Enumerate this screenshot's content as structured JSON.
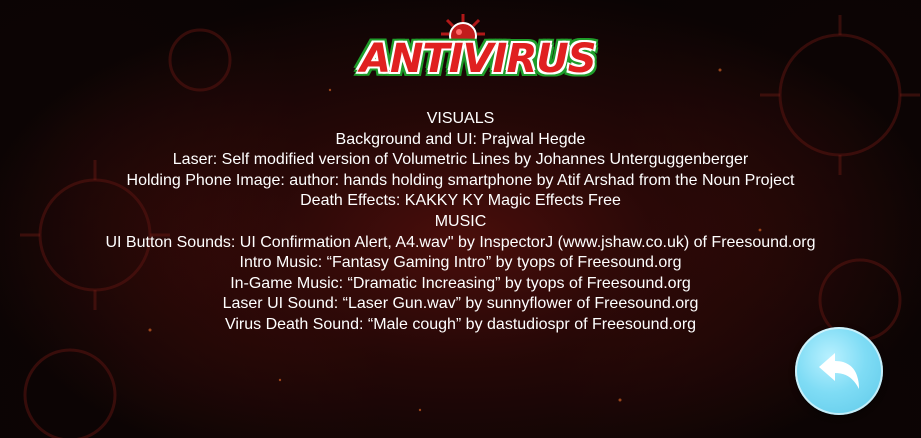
{
  "logo": {
    "text": "ANTIVIRUS",
    "colors": {
      "fill": "#e02020",
      "outline_inner": "#ffffff",
      "outline_outer": "#1f9c2a"
    }
  },
  "credits": {
    "lines": [
      "VISUALS",
      "Background and UI: Prajwal Hegde",
      "Laser: Self modified version of Volumetric Lines by Johannes Unterguggenberger",
      "Holding Phone Image: author: hands holding smartphone by Atif Arshad from the Noun Project",
      "Death Effects: KAKKY KY Magic Effects Free",
      "MUSIC",
      "UI Button Sounds: UI Confirmation Alert, A4.wav\" by InspectorJ (www.jshaw.co.uk) of Freesound.org",
      "Intro Music: “Fantasy Gaming Intro” by tyops of Freesound.org",
      "In-Game Music: “Dramatic Increasing” by tyops of Freesound.org",
      "Laser UI Sound: “Laser Gun.wav” by sunnyflower of Freesound.org",
      "Virus Death Sound: “Male cough” by dastudiospr of Freesound.org"
    ]
  },
  "back_button": {
    "icon": "back-arrow-icon",
    "color": "#7fdcf5"
  },
  "background": {
    "colors": {
      "base": "#120707",
      "glow": "#781410"
    }
  }
}
